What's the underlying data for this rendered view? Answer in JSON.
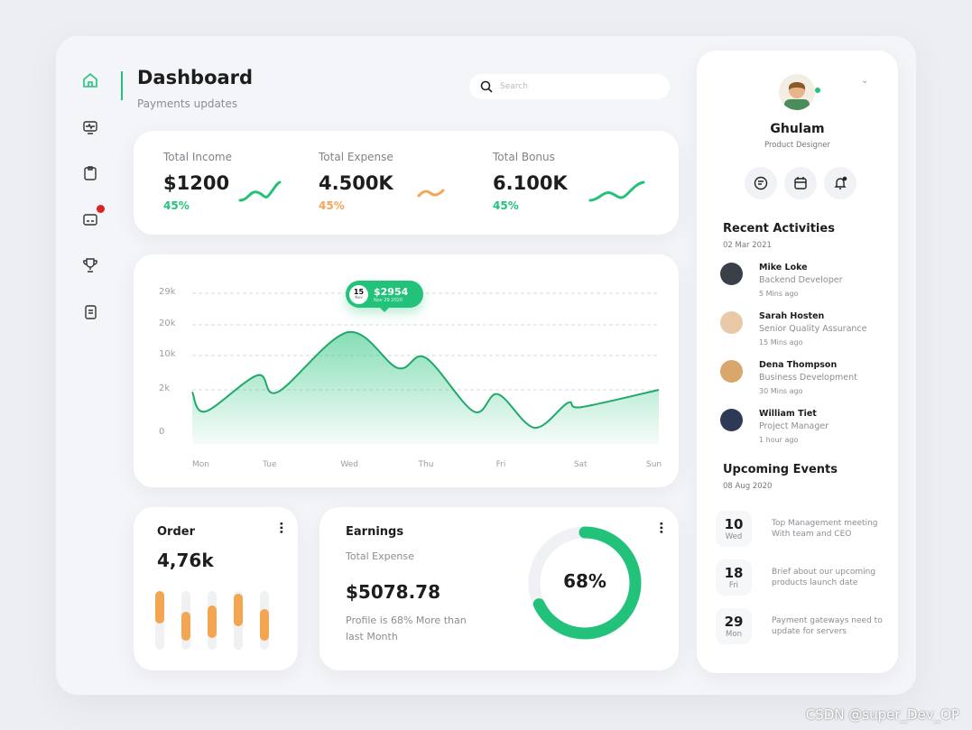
{
  "header": {
    "title": "Dashboard",
    "subtitle": "Payments updates",
    "search_placeholder": "Search"
  },
  "sidebar": {
    "items": [
      {
        "icon": "home-icon",
        "active": true
      },
      {
        "icon": "monitor-icon"
      },
      {
        "icon": "clipboard-icon"
      },
      {
        "icon": "card-icon",
        "badge": true
      },
      {
        "icon": "trophy-icon"
      },
      {
        "icon": "document-icon"
      }
    ]
  },
  "stats": [
    {
      "label": "Total Income",
      "value": "$1200",
      "percent": "45%",
      "color": "#23c27a"
    },
    {
      "label": "Total Expense",
      "value": "4.500K",
      "percent": "45%",
      "color": "#f3a552"
    },
    {
      "label": "Total Bonus",
      "value": "6.100K",
      "percent": "45%",
      "color": "#23c27a"
    }
  ],
  "chart_data": {
    "type": "area",
    "y_tick_labels": [
      "29k",
      "20k",
      "10k",
      "2k",
      "0"
    ],
    "categories": [
      "Mon",
      "Tue",
      "Wed",
      "Thu",
      "Fri",
      "Sat",
      "Sun"
    ],
    "points": [
      [
        0,
        1.9
      ],
      [
        0.17,
        1.0
      ],
      [
        0.84,
        5.4
      ],
      [
        1.1,
        1.9
      ],
      [
        2.0,
        17.6
      ],
      [
        2.64,
        7.1
      ],
      [
        3.0,
        9.5
      ],
      [
        3.62,
        1.0
      ],
      [
        3.93,
        1.8
      ],
      [
        4.4,
        0.25
      ],
      [
        4.83,
        1.4
      ],
      [
        5.0,
        1.2
      ],
      [
        6,
        2.0
      ]
    ],
    "color": "#23c27a",
    "grid": true,
    "tooltip": {
      "day": "15",
      "day_sub": "Nov",
      "value": "$2954",
      "date": "Nov 29 2020"
    }
  },
  "order": {
    "title": "Order",
    "value": "4,76k",
    "bars": [
      0.55,
      0.5,
      0.55,
      0.55,
      0.55
    ],
    "bar_offsets": [
      0.0,
      0.35,
      0.25,
      0.05,
      0.3
    ]
  },
  "earnings": {
    "title": "Earnings",
    "label": "Total Expense",
    "value": "$5078.78",
    "note": "Profile is 68% More than last Month",
    "percent": "68%",
    "progress": 0.68
  },
  "profile": {
    "name": "Ghulam",
    "role": "Product Designer"
  },
  "recent": {
    "title": "Recent Activities",
    "date": "02 Mar 2021",
    "items": [
      {
        "name": "Mike Loke",
        "role": "Backend Developer",
        "time": "5 Mins ago"
      },
      {
        "name": "Sarah Hosten",
        "role": "Senior Quality Assurance",
        "time": "15 Mins ago"
      },
      {
        "name": "Dena Thompson",
        "role": "Business Development",
        "time": "30 Mins ago"
      },
      {
        "name": "William Tiet",
        "role": "Project Manager",
        "time": "1 hour ago"
      }
    ]
  },
  "events": {
    "title": "Upcoming Events",
    "date": "08 Aug 2020",
    "items": [
      {
        "day": "10",
        "weekday": "Wed",
        "text": "Top Management meeting With team and CEO"
      },
      {
        "day": "18",
        "weekday": "Fri",
        "text": "Brief about our upcoming products launch date"
      },
      {
        "day": "29",
        "weekday": "Mon",
        "text": "Payment gateways need to update for servers"
      }
    ]
  },
  "watermark": "CSDN @super_Dev_OP"
}
